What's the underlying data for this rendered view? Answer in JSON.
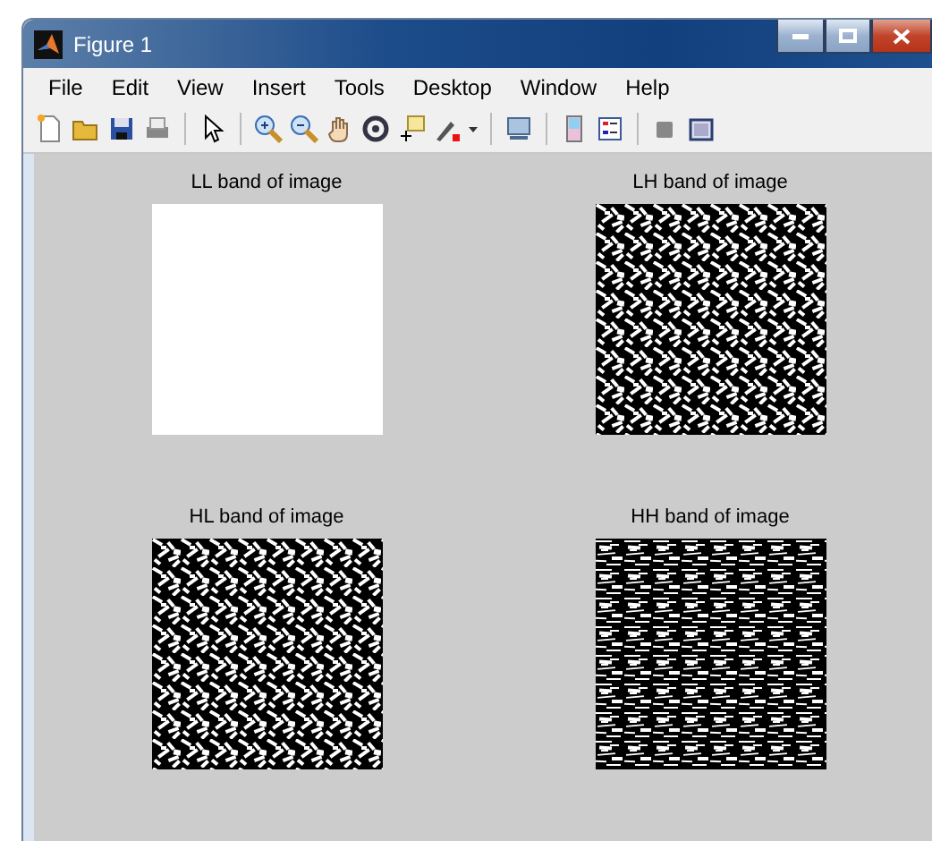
{
  "window": {
    "title": "Figure 1"
  },
  "menu": [
    "File",
    "Edit",
    "View",
    "Insert",
    "Tools",
    "Desktop",
    "Window",
    "Help"
  ],
  "plots": [
    {
      "title": "LL band of image",
      "kind": "blank"
    },
    {
      "title": "LH band of image",
      "kind": "picture"
    },
    {
      "title": "HL band of image",
      "kind": "picture"
    },
    {
      "title": "HH band of image",
      "kind": "picture"
    }
  ]
}
